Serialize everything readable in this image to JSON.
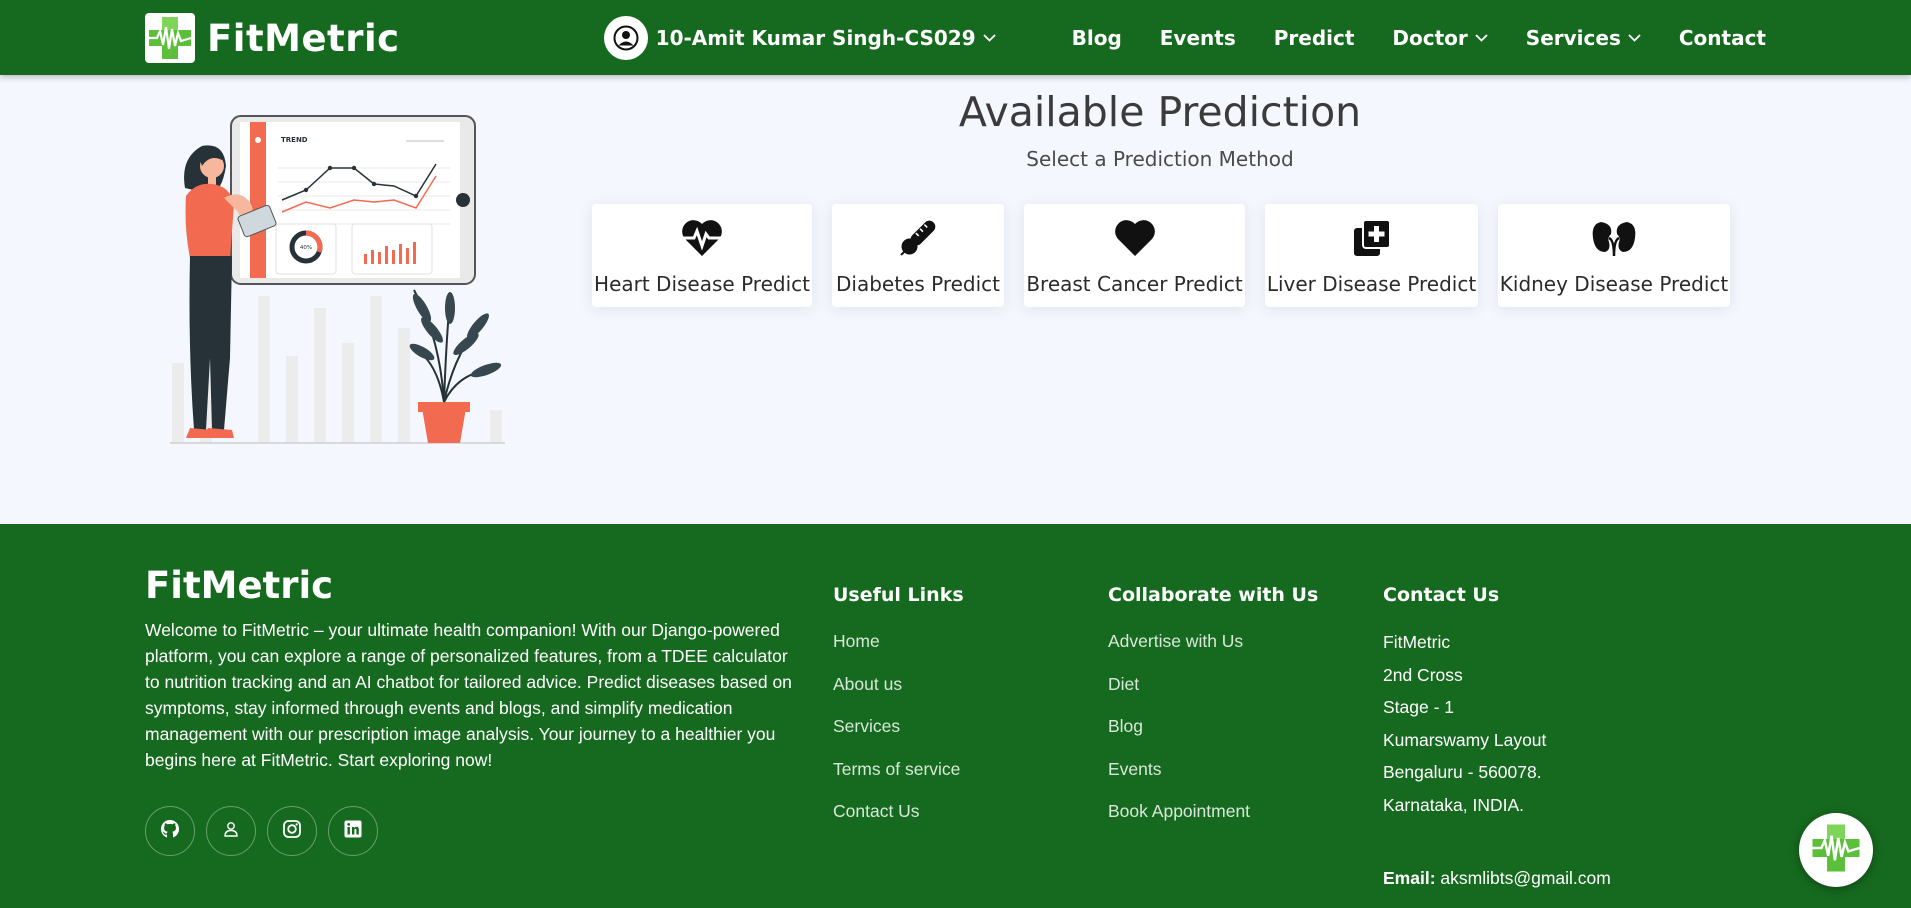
{
  "nav": {
    "brand": "FitMetric",
    "user": "10-Amit Kumar Singh-CS029",
    "links": [
      "Blog",
      "Events",
      "Predict"
    ],
    "doctor": "Doctor",
    "services": "Services",
    "contact": "Contact"
  },
  "main": {
    "title": "Available Prediction",
    "subtitle": "Select a Prediction Method",
    "cards": [
      {
        "label": "Heart Disease Predict",
        "icon": "heart-pulse-icon"
      },
      {
        "label": "Diabetes Predict",
        "icon": "thermometer-icon"
      },
      {
        "label": "Breast Cancer Predict",
        "icon": "heart-icon"
      },
      {
        "label": "Liver Disease Predict",
        "icon": "medical-files-icon"
      },
      {
        "label": "Kidney Disease Predict",
        "icon": "kidneys-icon"
      }
    ],
    "illustration": {
      "chart_title": "TREND",
      "gauge_text": "40%"
    }
  },
  "footer": {
    "brand": "FitMetric",
    "description": "Welcome to FitMetric – your ultimate health companion! With our Django-powered platform, you can explore a range of personalized features, from a TDEE calculator to nutrition tracking and an AI chatbot for tailored advice. Predict diseases based on symptoms, stay informed through events and blogs, and simplify medication management with our prescription image analysis. Your journey to a healthier you begins here at FitMetric. Start exploring now!",
    "socials": [
      "github-icon",
      "user-icon",
      "instagram-icon",
      "linkedin-icon"
    ],
    "useful_links": {
      "heading": "Useful Links",
      "items": [
        "Home",
        "About us",
        "Services",
        "Terms of service",
        "Contact Us"
      ]
    },
    "collaborate": {
      "heading": "Collaborate with Us",
      "items": [
        "Advertise with Us",
        "Diet",
        "Blog",
        "Events",
        "Book Appointment"
      ]
    },
    "contact": {
      "heading": "Contact Us",
      "lines": [
        "FitMetric",
        "2nd Cross",
        "Stage - 1",
        "Kumarswamy Layout",
        "Bengaluru - 560078.",
        "Karnataka, INDIA."
      ],
      "email_label": "Email:",
      "email": "aksmlibts@gmail.com"
    }
  },
  "colors": {
    "primary": "#166a1f",
    "background": "#f4f7fd",
    "accent": "#f26a4f"
  }
}
